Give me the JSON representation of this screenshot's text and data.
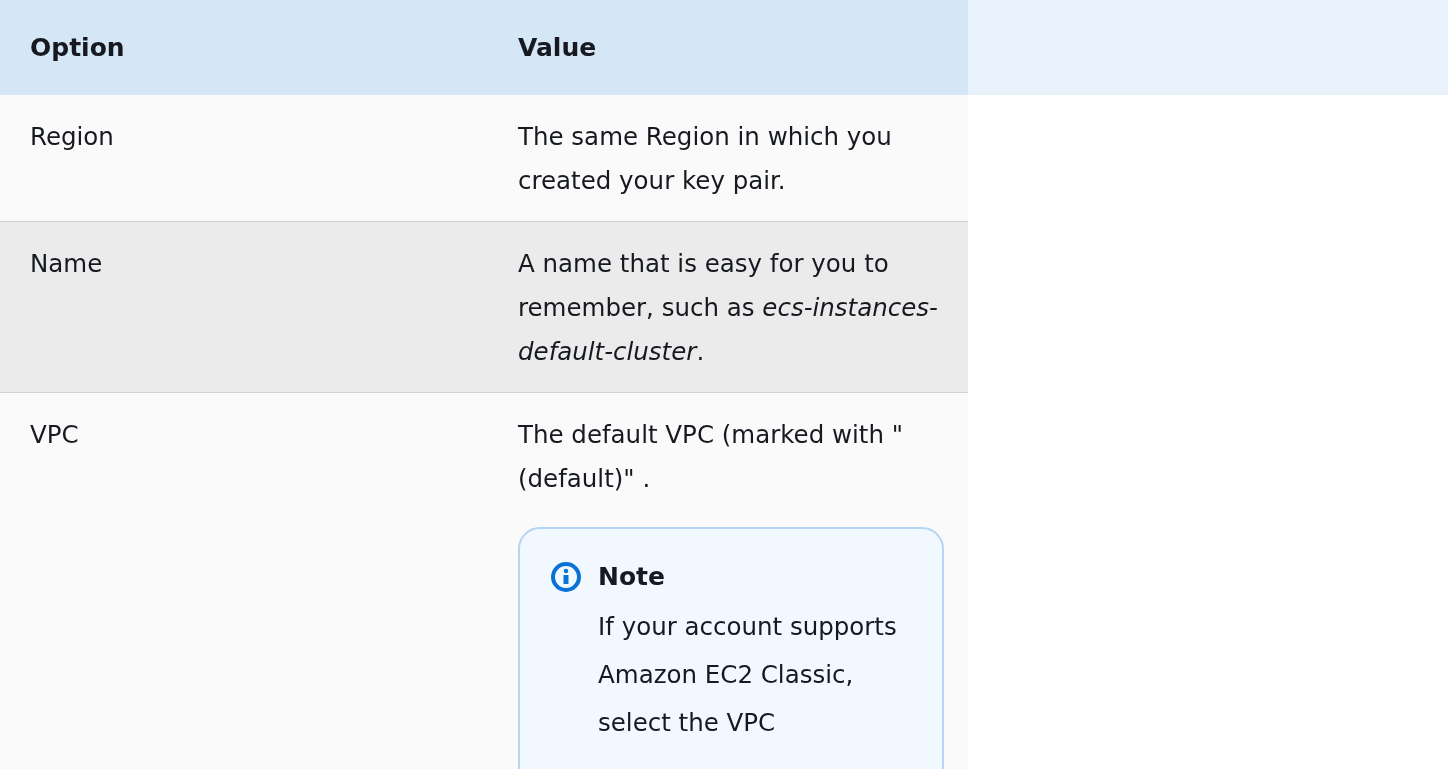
{
  "table": {
    "columns": [
      "Option",
      "Value"
    ],
    "rows": [
      {
        "option": "Region",
        "value": "The same Region in which you created your key pair.",
        "shaded": false
      },
      {
        "option": "Name",
        "value": "A name that is easy for you to remember, such as *ecs-instances-default-cluster*.",
        "shaded": true
      },
      {
        "option": "VPC",
        "value": "The default VPC (marked with \"(default)\" .",
        "shaded": false,
        "note": {
          "title": "Note",
          "text": "If your account supports Amazon EC2 Classic, select the VPC"
        }
      }
    ]
  }
}
